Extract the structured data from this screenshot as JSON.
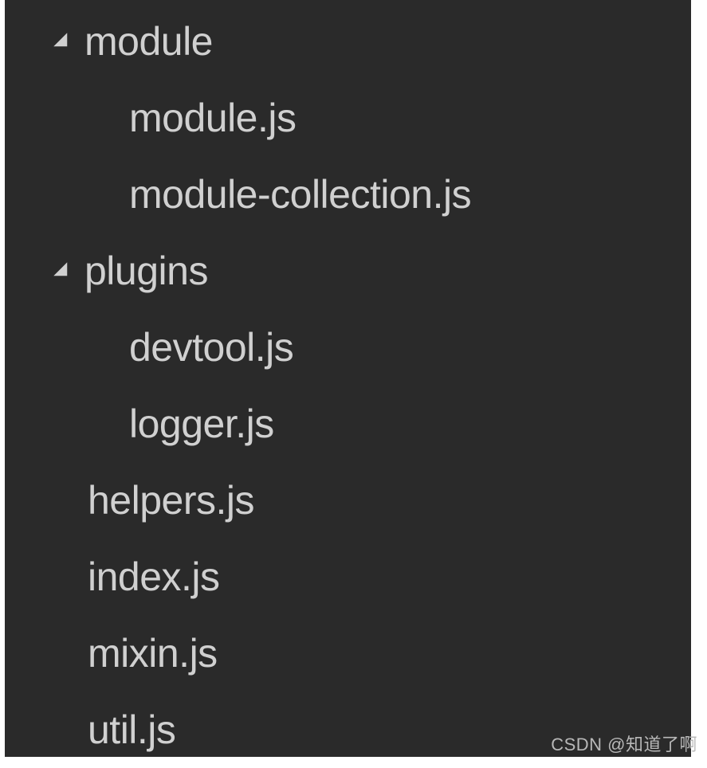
{
  "tree": {
    "folders": [
      {
        "name": "module",
        "expanded": true,
        "children": [
          "module.js",
          "module-collection.js"
        ]
      },
      {
        "name": "plugins",
        "expanded": true,
        "children": [
          "devtool.js",
          "logger.js"
        ]
      }
    ],
    "rootFiles": [
      "helpers.js",
      "index.js",
      "mixin.js",
      "util.js"
    ]
  },
  "watermark": "CSDN @知道了啊"
}
